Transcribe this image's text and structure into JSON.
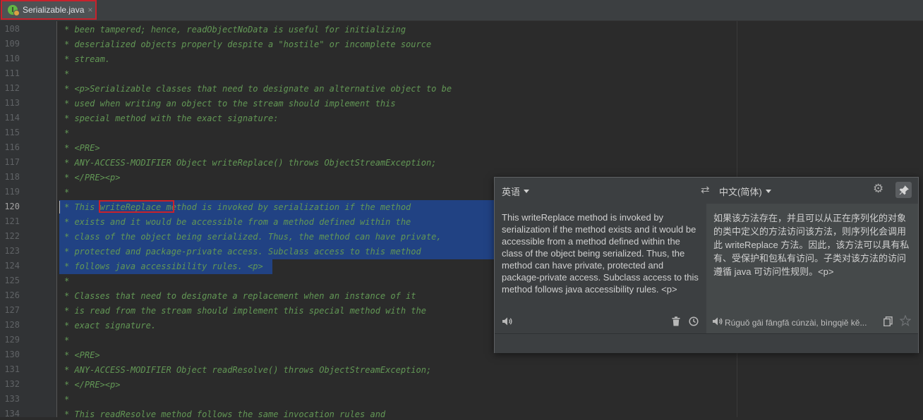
{
  "tab": {
    "filename": "Serializable.java",
    "close": "×"
  },
  "editor": {
    "current_line": 120,
    "lines": [
      {
        "n": "108",
        "t": "* been tampered; hence, readObjectNoData is useful for initializing"
      },
      {
        "n": "109",
        "t": "* deserialized objects properly despite a \"hostile\" or incomplete source"
      },
      {
        "n": "110",
        "t": "* stream."
      },
      {
        "n": "111",
        "t": "*"
      },
      {
        "n": "112",
        "t": "* <p>Serializable classes that need to designate an alternative object to be"
      },
      {
        "n": "113",
        "t": "* used when writing an object to the stream should implement this"
      },
      {
        "n": "114",
        "t": "* special method with the exact signature:"
      },
      {
        "n": "115",
        "t": "*"
      },
      {
        "n": "116",
        "t": "* <PRE>"
      },
      {
        "n": "117",
        "t": "* ANY-ACCESS-MODIFIER Object writeReplace() throws ObjectStreamException;"
      },
      {
        "n": "118",
        "t": "* </PRE><p>"
      },
      {
        "n": "119",
        "t": "*"
      },
      {
        "n": "120",
        "t": "* This writeReplace method is invoked by serialization if the method"
      },
      {
        "n": "121",
        "t": "* exists and it would be accessible from a method defined within the"
      },
      {
        "n": "122",
        "t": "* class of the object being serialized. Thus, the method can have private,"
      },
      {
        "n": "123",
        "t": "* protected and package-private access. Subclass access to this method"
      },
      {
        "n": "124",
        "t": "* follows java accessibility rules. <p>"
      },
      {
        "n": "125",
        "t": "*"
      },
      {
        "n": "126",
        "t": "* Classes that need to designate a replacement when an instance of it"
      },
      {
        "n": "127",
        "t": "* is read from the stream should implement this special method with the"
      },
      {
        "n": "128",
        "t": "* exact signature."
      },
      {
        "n": "129",
        "t": "*"
      },
      {
        "n": "130",
        "t": "* <PRE>"
      },
      {
        "n": "131",
        "t": "* ANY-ACCESS-MODIFIER Object readResolve() throws ObjectStreamException;"
      },
      {
        "n": "132",
        "t": "* </PRE><p>"
      },
      {
        "n": "133",
        "t": "*"
      },
      {
        "n": "134",
        "t": "* This readResolve method follows the same invocation rules and"
      }
    ]
  },
  "translator": {
    "source_lang": "英语",
    "target_lang": "中文(简体)",
    "source_text": "This writeReplace method is invoked by serialization if the method exists and it would be accessible from a method defined within the class of the object being serialized. Thus, the method can have private, protected and package-private access. Subclass access to this method follows java accessibility rules. <p>",
    "translated_text": "如果该方法存在，并且可以从正在序列化的对象的类中定义的方法访问该方法，则序列化会调用此 writeReplace 方法。因此，该方法可以具有私有、受保护和包私有访问。子类对该方法的访问遵循 java 可访问性规则。<p>",
    "transliteration": "Rúguǒ gāi fāngfǎ cúnzài, bìngqiě kě...",
    "icons": {
      "swap": "swap-icon",
      "settings": "gear-icon",
      "pin": "pin-icon",
      "speak_source": "speaker-icon",
      "clear": "trash-icon",
      "history": "clock-icon",
      "speak_target": "speaker-icon",
      "copy": "copy-icon",
      "favorite": "star-icon"
    }
  },
  "colors": {
    "comment": "#629755",
    "selection": "#214283",
    "highlight_box": "#c8222c",
    "editor_bg": "#2b2b2b",
    "popup_bg": "#3c3f41"
  }
}
